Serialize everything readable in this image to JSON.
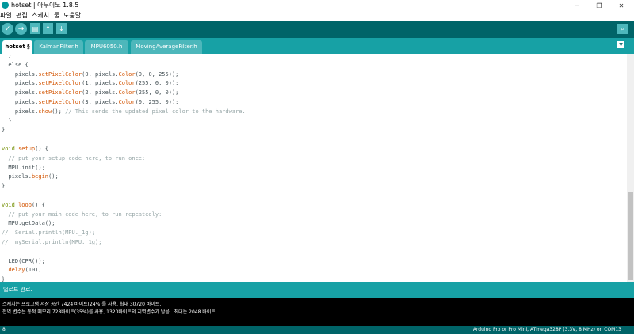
{
  "window": {
    "title": "hotset | 아두이노 1.8.5",
    "minimize": "─",
    "maximize": "❐",
    "close": "✕"
  },
  "menu": [
    "파일",
    "편집",
    "스케치",
    "툴",
    "도움말"
  ],
  "toolbar": {
    "verify": "✓",
    "upload": "→",
    "new": "▤",
    "open": "↑",
    "save": "↓",
    "serial_monitor": "⌕"
  },
  "tabs": [
    {
      "label": "hotset §",
      "active": true
    },
    {
      "label": "KalmanFilter.h",
      "active": false
    },
    {
      "label": "MPU6050.h",
      "active": false
    },
    {
      "label": "MovingAverageFilter.h",
      "active": false
    }
  ],
  "tab_menu": "▼",
  "code": [
    {
      "type": "text",
      "text": "  }"
    },
    {
      "type": "text",
      "text": "  else {"
    },
    {
      "type": "call",
      "pre": "    pixels.",
      "fn": "setPixelColor",
      "mid": "(0, pixels.",
      "fn2": "Color",
      "post": "(0, 0, 255));"
    },
    {
      "type": "call",
      "pre": "    pixels.",
      "fn": "setPixelColor",
      "mid": "(1, pixels.",
      "fn2": "Color",
      "post": "(255, 0, 0));"
    },
    {
      "type": "call",
      "pre": "    pixels.",
      "fn": "setPixelColor",
      "mid": "(2, pixels.",
      "fn2": "Color",
      "post": "(255, 0, 0));"
    },
    {
      "type": "call",
      "pre": "    pixels.",
      "fn": "setPixelColor",
      "mid": "(3, pixels.",
      "fn2": "Color",
      "post": "(0, 255, 0));"
    },
    {
      "type": "show",
      "pre": "    pixels.",
      "fn": "show",
      "post": "(); ",
      "comment": "// This sends the updated pixel color to the hardware."
    },
    {
      "type": "text",
      "text": "  }"
    },
    {
      "type": "text",
      "text": "}"
    },
    {
      "type": "blank"
    },
    {
      "type": "func",
      "kw": "void",
      "fn": "setup",
      "post": "() {"
    },
    {
      "type": "comment",
      "text": "  // put your setup code here, to run once:"
    },
    {
      "type": "text",
      "text": "  MPU.init();"
    },
    {
      "type": "call1",
      "pre": "  pixels.",
      "fn": "begin",
      "post": "();"
    },
    {
      "type": "text",
      "text": "}"
    },
    {
      "type": "blank"
    },
    {
      "type": "func",
      "kw": "void",
      "fn": "loop",
      "post": "() {"
    },
    {
      "type": "comment",
      "text": "  // put your main code here, to run repeatedly:"
    },
    {
      "type": "text",
      "text": "  MPU.getData();"
    },
    {
      "type": "comment",
      "text": "//  Serial.println(MPU._1g);"
    },
    {
      "type": "comment",
      "text": "//  mySerial.println(MPU._1g);"
    },
    {
      "type": "blank"
    },
    {
      "type": "text",
      "text": "  LED(CPR());"
    },
    {
      "type": "call1",
      "pre": "  ",
      "fn": "delay",
      "post": "(10);"
    },
    {
      "type": "text",
      "text": "}"
    }
  ],
  "status": {
    "message": "업로드 완료."
  },
  "console": [
    "스케치는 프로그램 저장 공간 7424 바이트(24%)를 사용. 최대 30720 바이트.",
    "전역 변수는 동적 메모리 728바이트(35%)를 사용, 1320바이트의 지역변수가 남음.  최대는 2048 바이트."
  ],
  "footer": {
    "line": "8",
    "board": "Arduino Pro or Pro Mini, ATmega328P (3.3V, 8 MHz) on COM13"
  },
  "colors": {
    "toolbar": "#006468",
    "tabbar": "#17a1a5",
    "button": "#4db7bb",
    "console": "#000000",
    "keyword": "#728e00",
    "function": "#d35400",
    "comment": "#95a5a6"
  }
}
